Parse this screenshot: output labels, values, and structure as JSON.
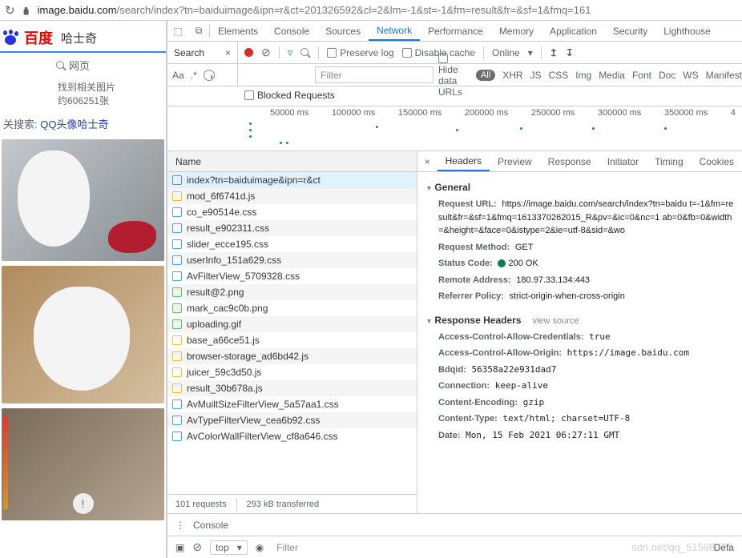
{
  "addr": {
    "host": "image.baidu.com",
    "path": "/search/index?tn=baiduimage&ipn=r&ct=201326592&cl=2&lm=-1&st=-1&fm=result&fr=&sf=1&fmq=161"
  },
  "page": {
    "brand": "百度",
    "query": "哈士奇",
    "subnav": "网页",
    "stats_a": "找到相关图片",
    "stats_b": "约606251张",
    "related_label": "关搜索:",
    "related_link": "QQ头像哈士奇"
  },
  "devtabs": [
    "Elements",
    "Console",
    "Sources",
    "Network",
    "Performance",
    "Memory",
    "Application",
    "Security",
    "Lighthouse"
  ],
  "devtab_active": 3,
  "search_panel": "Search",
  "aa": "Aa",
  "dotstar": ".*",
  "net_opts": {
    "preserve": "Preserve log",
    "disable": "Disable cache",
    "online": "Online"
  },
  "filter_placeholder": "Filter",
  "hide_urls": "Hide data URLs",
  "type_filters": [
    "All",
    "XHR",
    "JS",
    "CSS",
    "Img",
    "Media",
    "Font",
    "Doc",
    "WS",
    "Manifest"
  ],
  "blocked": "Blocked Requests",
  "timeline_ticks": [
    "50000 ms",
    "100000 ms",
    "150000 ms",
    "200000 ms",
    "250000 ms",
    "300000 ms",
    "350000 ms"
  ],
  "name_hdr": "Name",
  "requests": [
    {
      "n": "index?tn=baiduimage&ipn=r&ct",
      "t": "doc",
      "sel": true
    },
    {
      "n": "mod_6f6741d.js",
      "t": "js"
    },
    {
      "n": "co_e90514e.css",
      "t": "css"
    },
    {
      "n": "result_e902311.css",
      "t": "css"
    },
    {
      "n": "slider_ecce195.css",
      "t": "css"
    },
    {
      "n": "userInfo_151a629.css",
      "t": "css"
    },
    {
      "n": "AvFilterView_5709328.css",
      "t": "css"
    },
    {
      "n": "result@2.png",
      "t": "img"
    },
    {
      "n": "mark_cac9c0b.png",
      "t": "img"
    },
    {
      "n": "uploading.gif",
      "t": "img"
    },
    {
      "n": "base_a66ce51.js",
      "t": "js"
    },
    {
      "n": "browser-storage_ad6bd42.js",
      "t": "js"
    },
    {
      "n": "juicer_59c3d50.js",
      "t": "js"
    },
    {
      "n": "result_30b678a.js",
      "t": "js"
    },
    {
      "n": "AvMuiltSizeFilterView_5a57aa1.css",
      "t": "css"
    },
    {
      "n": "AvTypeFilterView_cea6b92.css",
      "t": "css"
    },
    {
      "n": "AvColorWallFilterView_cf8a646.css",
      "t": "css"
    }
  ],
  "summary": {
    "count": "101 requests",
    "size": "293 kB transferred"
  },
  "detail_tabs": [
    "Headers",
    "Preview",
    "Response",
    "Initiator",
    "Timing",
    "Cookies"
  ],
  "detail_tab_active": 0,
  "general_hdr": "General",
  "general": {
    "url_k": "Request URL:",
    "url_v": "https://image.baidu.com/search/index?tn=baidu t=-1&fm=result&fr=&sf=1&fmq=1613370262015_R&pv=&ic=0&nc=1 ab=0&fb=0&width=&height=&face=0&istype=2&ie=utf-8&sid=&wo",
    "method_k": "Request Method:",
    "method_v": "GET",
    "status_k": "Status Code:",
    "status_v": "200 OK",
    "remote_k": "Remote Address:",
    "remote_v": "180.97.33.134:443",
    "ref_k": "Referrer Policy:",
    "ref_v": "strict-origin-when-cross-origin"
  },
  "resp_hdr": "Response Headers",
  "view_source": "view source",
  "resp": [
    {
      "k": "Access-Control-Allow-Credentials:",
      "v": "true"
    },
    {
      "k": "Access-Control-Allow-Origin:",
      "v": "https://image.baidu.com"
    },
    {
      "k": "Bdqid:",
      "v": "56358a22e931dad7"
    },
    {
      "k": "Connection:",
      "v": "keep-alive"
    },
    {
      "k": "Content-Encoding:",
      "v": "gzip"
    },
    {
      "k": "Content-Type:",
      "v": "text/html; charset=UTF-8"
    },
    {
      "k": "Date:",
      "v": "Mon, 15 Feb 2021 06:27:11 GMT"
    }
  ],
  "console": {
    "label": "Console",
    "top": "top",
    "filter": "Filter",
    "level": "Defa"
  },
  "watermark": "sdn.net/qq_51598376"
}
